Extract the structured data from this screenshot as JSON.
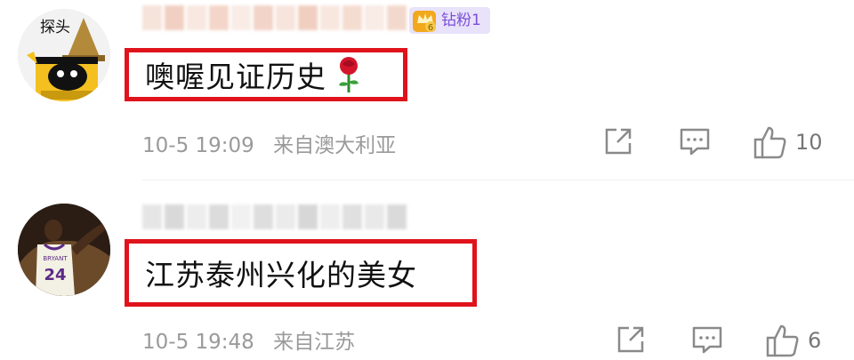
{
  "comments": [
    {
      "avatar_label": "探头",
      "text": "噢喔见证历史",
      "badge": "钻粉1",
      "time": "10-5 19:09",
      "location": "来自澳大利亚",
      "likes": "10",
      "emoji": "rose-icon"
    },
    {
      "avatar_jersey_number": "24",
      "text": "江苏泰州兴化的美女",
      "time": "10-5 19:48",
      "location": "来自江苏",
      "likes": "6"
    }
  ],
  "colors": {
    "highlight_border": "#e0131c",
    "meta_text": "#9a9a9a",
    "badge_bg": "#e9e2fb",
    "badge_text": "#7a4fd6"
  }
}
